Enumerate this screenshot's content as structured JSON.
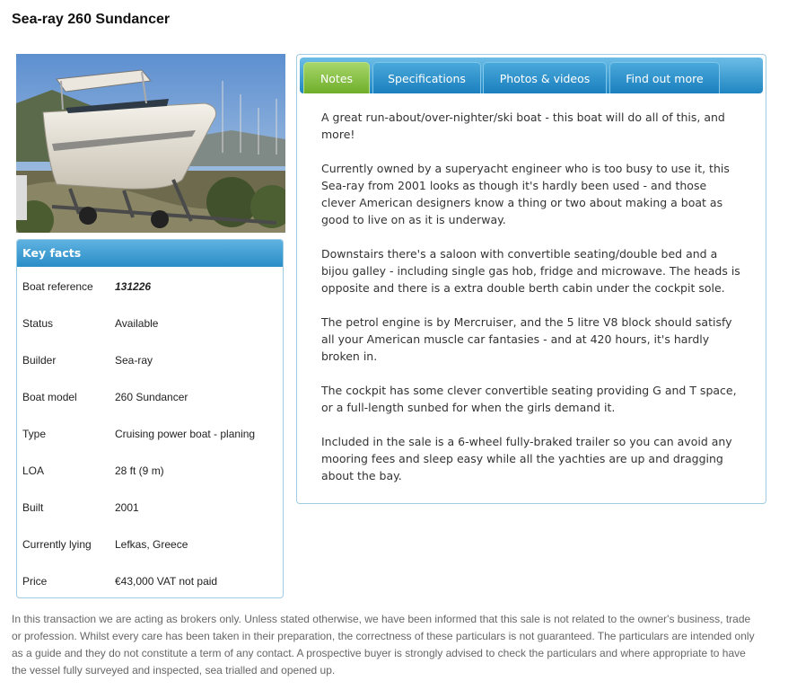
{
  "page": {
    "title": "Sea-ray 260 Sundancer"
  },
  "photo": {
    "alt": "Sea-ray 260 Sundancer on trailer"
  },
  "key_facts": {
    "heading": "Key facts",
    "rows": [
      {
        "label": "Boat reference",
        "value": "131226"
      },
      {
        "label": "Status",
        "value": "Available"
      },
      {
        "label": "Builder",
        "value": "Sea-ray"
      },
      {
        "label": "Boat model",
        "value": "260 Sundancer"
      },
      {
        "label": "Type",
        "value": "Cruising power boat - planing"
      },
      {
        "label": "LOA",
        "value": "28 ft (9 m)"
      },
      {
        "label": "Built",
        "value": "2001"
      },
      {
        "label": "Currently lying",
        "value": "Lefkas, Greece"
      },
      {
        "label": "Price",
        "value": "€43,000 VAT not paid"
      }
    ]
  },
  "tabs": [
    {
      "label": "Notes",
      "active": true
    },
    {
      "label": "Specifications",
      "active": false
    },
    {
      "label": "Photos & videos",
      "active": false
    },
    {
      "label": "Find out more",
      "active": false
    }
  ],
  "notes": [
    "A great run-about/over-nighter/ski boat - this boat will do all of this, and more!",
    "Currently owned by a superyacht engineer who is too busy to use it, this Sea-ray from 2001 looks as though it's hardly been used - and those clever American designers know a thing or two about making a boat as good to live on as it is underway.",
    "Downstairs there's a saloon with convertible seating/double bed and a bijou galley - including single gas hob, fridge and microwave. The heads is opposite and there is a extra double berth cabin under the cockpit sole.",
    "The petrol engine is by Mercruiser, and the 5 litre V8 block should satisfy all your American muscle car fantasies - and at 420 hours, it's hardly broken in.",
    "The cockpit has some clever convertible seating providing G and T space, or a full-length sunbed for when the girls demand it.",
    "Included in the sale is a 6-wheel fully-braked trailer so you can avoid any mooring fees and sleep easy while all the yachties are up and dragging about the bay."
  ],
  "disclaimer": "In this transaction we are acting as brokers only. Unless stated otherwise, we have been informed that this sale is not related to the owner's business, trade or profession. Whilst every care has been taken in their preparation, the correctness of these particulars is not guaranteed. The particulars are intended only as a guide and they do not constitute a term of any contact. A prospective buyer is strongly advised to check the particulars and where appropriate to have the vessel fully surveyed and inspected, sea trialled and opened up.",
  "colors": {
    "tab_active": "#7cb83a",
    "tab_inactive": "#2b8fca",
    "panel_border": "#9fcbe3"
  }
}
